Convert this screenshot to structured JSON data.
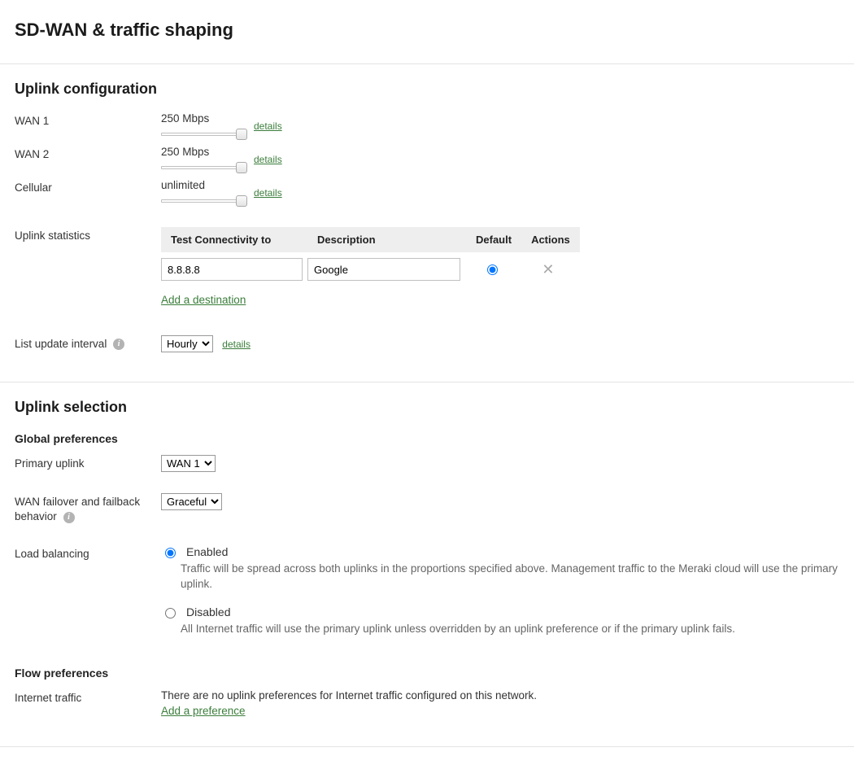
{
  "page_title": "SD-WAN & traffic shaping",
  "uplink_config": {
    "heading": "Uplink configuration",
    "wan1": {
      "label": "WAN 1",
      "value": "250 Mbps",
      "details": "details"
    },
    "wan2": {
      "label": "WAN 2",
      "value": "250 Mbps",
      "details": "details"
    },
    "cellular": {
      "label": "Cellular",
      "value": "unlimited",
      "details": "details"
    },
    "stats": {
      "label": "Uplink statistics",
      "th_test": "Test Connectivity to",
      "th_desc": "Description",
      "th_default": "Default",
      "th_actions": "Actions",
      "row_test": "8.8.8.8",
      "row_desc": "Google",
      "add_link": "Add a destination"
    },
    "update_interval": {
      "label": "List update interval",
      "value": "Hourly",
      "details": "details"
    }
  },
  "uplink_selection": {
    "heading": "Uplink selection",
    "global_heading": "Global preferences",
    "primary": {
      "label": "Primary uplink",
      "value": "WAN 1"
    },
    "failover": {
      "label": "WAN failover and failback behavior",
      "value": "Graceful"
    },
    "load_balancing": {
      "label": "Load balancing",
      "enabled_label": "Enabled",
      "enabled_desc": "Traffic will be spread across both uplinks in the proportions specified above. Management traffic to the Meraki cloud will use the primary uplink.",
      "disabled_label": "Disabled",
      "disabled_desc": "All Internet traffic will use the primary uplink unless overridden by an uplink preference or if the primary uplink fails."
    },
    "flow_heading": "Flow preferences",
    "internet": {
      "label": "Internet traffic",
      "empty": "There are no uplink preferences for Internet traffic configured on this network.",
      "add_link": "Add a preference"
    }
  }
}
